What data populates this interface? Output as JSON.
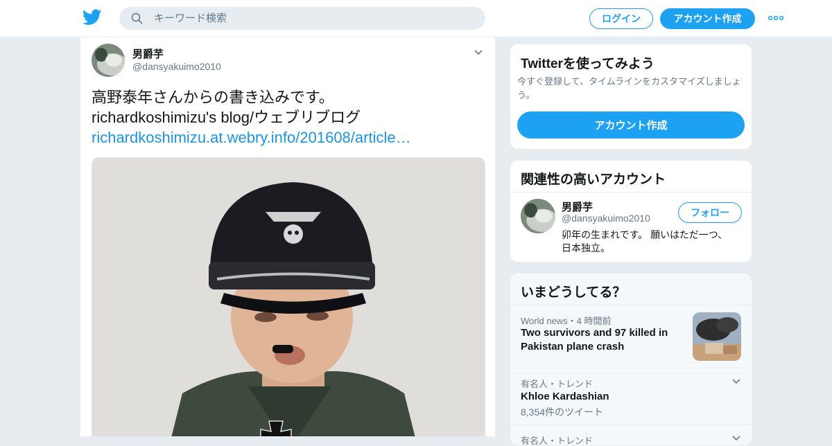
{
  "header": {
    "search_placeholder": "キーワード検索",
    "login_label": "ログイン",
    "signup_label": "アカウント作成"
  },
  "tweet": {
    "name": "男爵芋",
    "handle": "@dansyakuimo2010",
    "text_line1": "高野泰年さんからの書き込みです。",
    "text_line2": "richardkoshimizu's blog/ウェブリブログ",
    "link": "richardkoshimizu.at.webry.info/201608/article…"
  },
  "signup_card": {
    "title": "Twitterを使ってみよう",
    "body": "今すぐ登録して、タイムラインをカスタマイズしましょう。",
    "button": "アカウント作成"
  },
  "related_card": {
    "title": "関連性の高いアカウント",
    "name": "男爵芋",
    "handle": "@dansyakuimo2010",
    "bio": "卯年の生まれです。 願いはただ一つ、日本独立。",
    "follow_label": "フォロー"
  },
  "trends": {
    "title": "いまどうしてる？",
    "items": [
      {
        "meta": "World news・4 時間前",
        "headline": "Two survivors and 97 killed in Pakistan plane crash"
      },
      {
        "meta": "有名人・トレンド",
        "headline": "Khloe Kardashian",
        "sub": "8,354件のツイート"
      },
      {
        "meta": "有名人・トレンド"
      }
    ]
  },
  "colors": {
    "accent": "#1da1f2",
    "link": "#1b95e0",
    "background": "#e6ecf0"
  }
}
